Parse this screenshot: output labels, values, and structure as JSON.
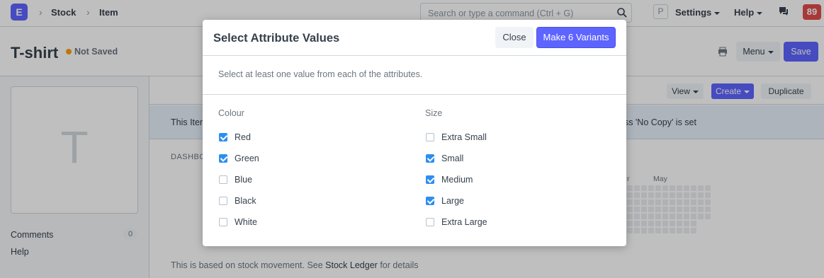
{
  "navbar": {
    "logo_letter": "E",
    "breadcrumbs": [
      "Stock",
      "Item"
    ],
    "search_placeholder": "Search or type a command (Ctrl + G)",
    "user_initial": "P",
    "settings_label": "Settings",
    "help_label": "Help",
    "notification_count": "89"
  },
  "page": {
    "title": "T-shirt",
    "status": "Not Saved",
    "menu_label": "Menu",
    "save_label": "Save"
  },
  "sidebar": {
    "image_letter": "T",
    "comments_label": "Comments",
    "comments_count": "0",
    "help_label": "Help"
  },
  "form": {
    "view_label": "View",
    "create_label": "Create",
    "duplicate_label": "Duplicate",
    "info_left": "This Item",
    "info_right": "ess 'No Copy' is set",
    "dashboard_label": "DASHBO",
    "months": [
      "r",
      "May"
    ],
    "footnote_prefix": "This is based on stock movement. See",
    "footnote_link": "Stock Ledger",
    "footnote_suffix": "for details"
  },
  "modal": {
    "title": "Select Attribute Values",
    "close_label": "Close",
    "primary_label": "Make 6 Variants",
    "description": "Select at least one value from each of the attributes.",
    "attributes": [
      {
        "name": "Colour",
        "options": [
          {
            "label": "Red",
            "checked": true
          },
          {
            "label": "Green",
            "checked": true
          },
          {
            "label": "Blue",
            "checked": false
          },
          {
            "label": "Black",
            "checked": false
          },
          {
            "label": "White",
            "checked": false
          }
        ]
      },
      {
        "name": "Size",
        "options": [
          {
            "label": "Extra Small",
            "checked": false
          },
          {
            "label": "Small",
            "checked": true
          },
          {
            "label": "Medium",
            "checked": true
          },
          {
            "label": "Large",
            "checked": true
          },
          {
            "label": "Extra Large",
            "checked": false
          }
        ]
      }
    ]
  },
  "colors": {
    "accent": "#5e64ff",
    "checkbox_checked": "#2d8ef0",
    "notification": "#e24c4c",
    "unsaved_dot": "#ffa00a"
  }
}
